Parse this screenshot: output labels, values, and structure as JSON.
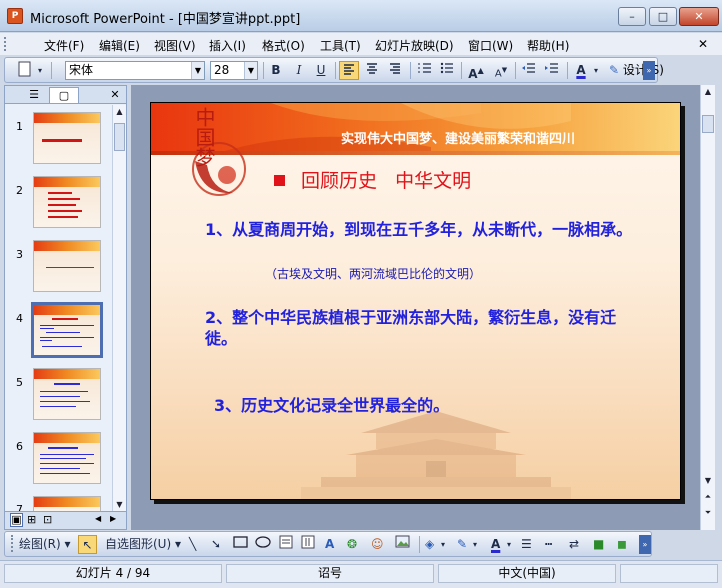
{
  "window": {
    "title": "Microsoft PowerPoint - [中国梦宣讲ppt.ppt]",
    "app_icon_label": "P"
  },
  "window_controls": {
    "minimize": "–",
    "maximize": "□",
    "close": "✕"
  },
  "menu": {
    "items": [
      "文件(F)",
      "编辑(E)",
      "视图(V)",
      "插入(I)",
      "格式(O)",
      "工具(T)",
      "幻灯片放映(D)",
      "窗口(W)",
      "帮助(H)"
    ],
    "close_doc": "✕"
  },
  "toolbar": {
    "font_name": "宋体",
    "font_size": "28",
    "bold": "B",
    "italic": "I",
    "underline": "U",
    "design_label": "设计(S)"
  },
  "outline_pane": {
    "thumb_numbers": [
      "1",
      "2",
      "3",
      "4",
      "5",
      "6",
      "7"
    ],
    "selected_slide": "4",
    "tab_outline_icon": "outline-icon",
    "tab_slides_icon": "slides-icon"
  },
  "slide": {
    "banner": "实现伟大中国梦、建设美丽繁荣和谐四川",
    "logo_text": "中国梦",
    "heading": "回顾历史   中华文明",
    "points": [
      "1、从夏商周开始，到现在五千多年，从未断代，一脉相承。",
      "2、整个中华民族植根于亚洲东部大陆，繁衍生息，没有迁徙。",
      "3、历史文化记录全世界最全的。"
    ],
    "note": "（古埃及文明、两河流域巴比伦的文明）"
  },
  "drawbar": {
    "draw_label": "绘图(R)",
    "autoshape_label": "自选图形(U)"
  },
  "status": {
    "slide_info": "幻灯片 4 / 94",
    "design_name": "诏号",
    "language": "中文(中国)"
  },
  "colors": {
    "accent_red": "#e0121a",
    "text_blue": "#2222dd",
    "banner_orange": "#f0681c"
  }
}
